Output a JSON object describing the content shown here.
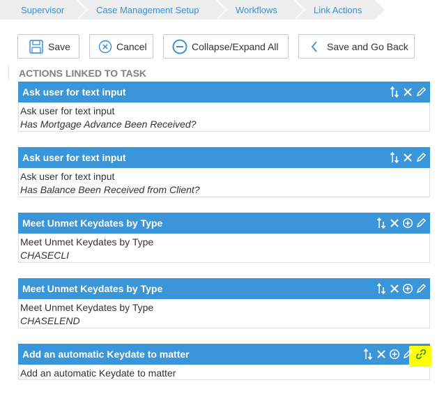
{
  "breadcrumb": {
    "items": [
      {
        "label": "Supervisor"
      },
      {
        "label": "Case Management Setup"
      },
      {
        "label": "Workflows"
      },
      {
        "label": "Link Actions"
      }
    ]
  },
  "toolbar": {
    "save_label": "Save",
    "cancel_label": "Cancel",
    "collapse_label": "Collapse/Expand All",
    "back_label": "Save and Go Back"
  },
  "section": {
    "title": "ACTIONS LINKED TO TASK"
  },
  "actions": [
    {
      "title": "Ask user for text input",
      "line1": "Ask user for text input",
      "line2": "Has Mortgage Advance Been Received?",
      "icons": [
        "reorder-icon",
        "delete-icon",
        "edit-icon"
      ]
    },
    {
      "title": "Ask user for text input",
      "line1": "Ask user for text input",
      "line2": "Has Balance Been Received from Client?",
      "icons": [
        "reorder-icon",
        "delete-icon",
        "edit-icon"
      ]
    },
    {
      "title": "Meet Unmet Keydates by Type",
      "line1": "Meet Unmet Keydates by Type",
      "line2": "CHASECLI",
      "icons": [
        "reorder-icon",
        "delete-icon",
        "add-icon",
        "edit-icon"
      ]
    },
    {
      "title": "Meet Unmet Keydates by Type",
      "line1": "Meet Unmet Keydates by Type",
      "line2": "CHASELEND",
      "icons": [
        "reorder-icon",
        "delete-icon",
        "add-icon",
        "edit-icon"
      ]
    },
    {
      "title": "Add an automatic Keydate to matter",
      "line1": "Add an automatic Keydate to matter",
      "line2": "",
      "icons": [
        "reorder-icon",
        "delete-icon",
        "add-icon",
        "edit-icon",
        "link-icon"
      ]
    }
  ],
  "colors": {
    "header_blue": "#3a95d9",
    "link_blue": "#3a8fd8",
    "highlight": "#ffff00",
    "icon_green": "#2a8a2a"
  }
}
